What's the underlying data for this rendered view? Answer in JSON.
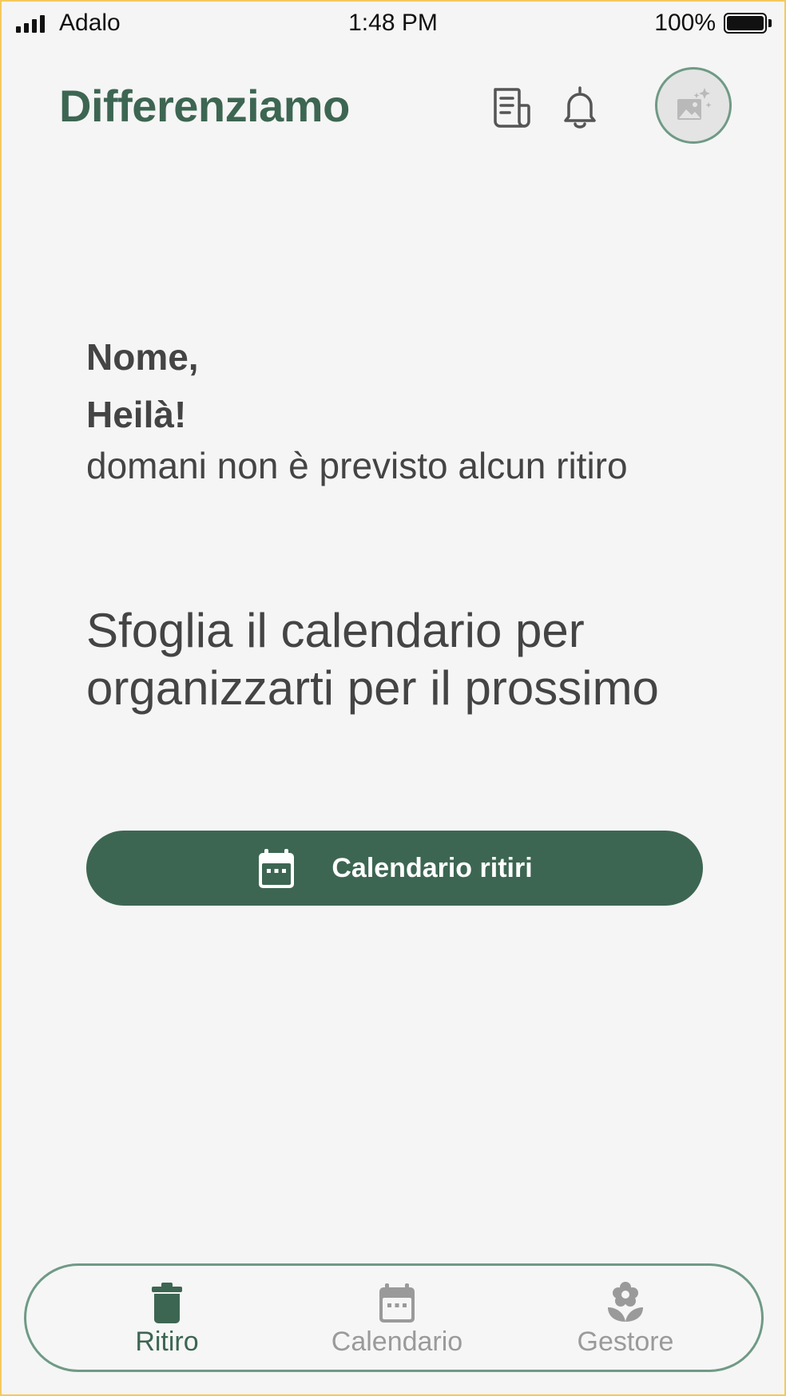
{
  "status_bar": {
    "carrier": "Adalo",
    "time": "1:48 PM",
    "battery_percent": "100%",
    "signal_bars": 4
  },
  "header": {
    "app_title": "Differenziamo",
    "icons": [
      "newspaper-icon",
      "bell-icon"
    ],
    "avatar_icon": "image-placeholder-icon"
  },
  "greeting": {
    "name": "Nome,",
    "hello": "Heilà!",
    "message": "domani non è previsto alcun ritiro"
  },
  "promo_text": "Sfoglia il calendario per organizzarti per il prossimo",
  "cta": {
    "label": "Calendario ritiri",
    "icon": "calendar-icon"
  },
  "tab_bar": {
    "tabs": [
      {
        "label": "Ritiro",
        "icon": "trash-icon",
        "active": true
      },
      {
        "label": "Calendario",
        "icon": "calendar-icon",
        "active": false
      },
      {
        "label": "Gestore",
        "icon": "flower-icon",
        "active": false
      }
    ]
  },
  "colors": {
    "brand_green": "#3d6652",
    "border_green": "#6f9a86",
    "text_dark": "#444444",
    "inactive_gray": "#9a9a9a",
    "background": "#f5f5f5"
  }
}
